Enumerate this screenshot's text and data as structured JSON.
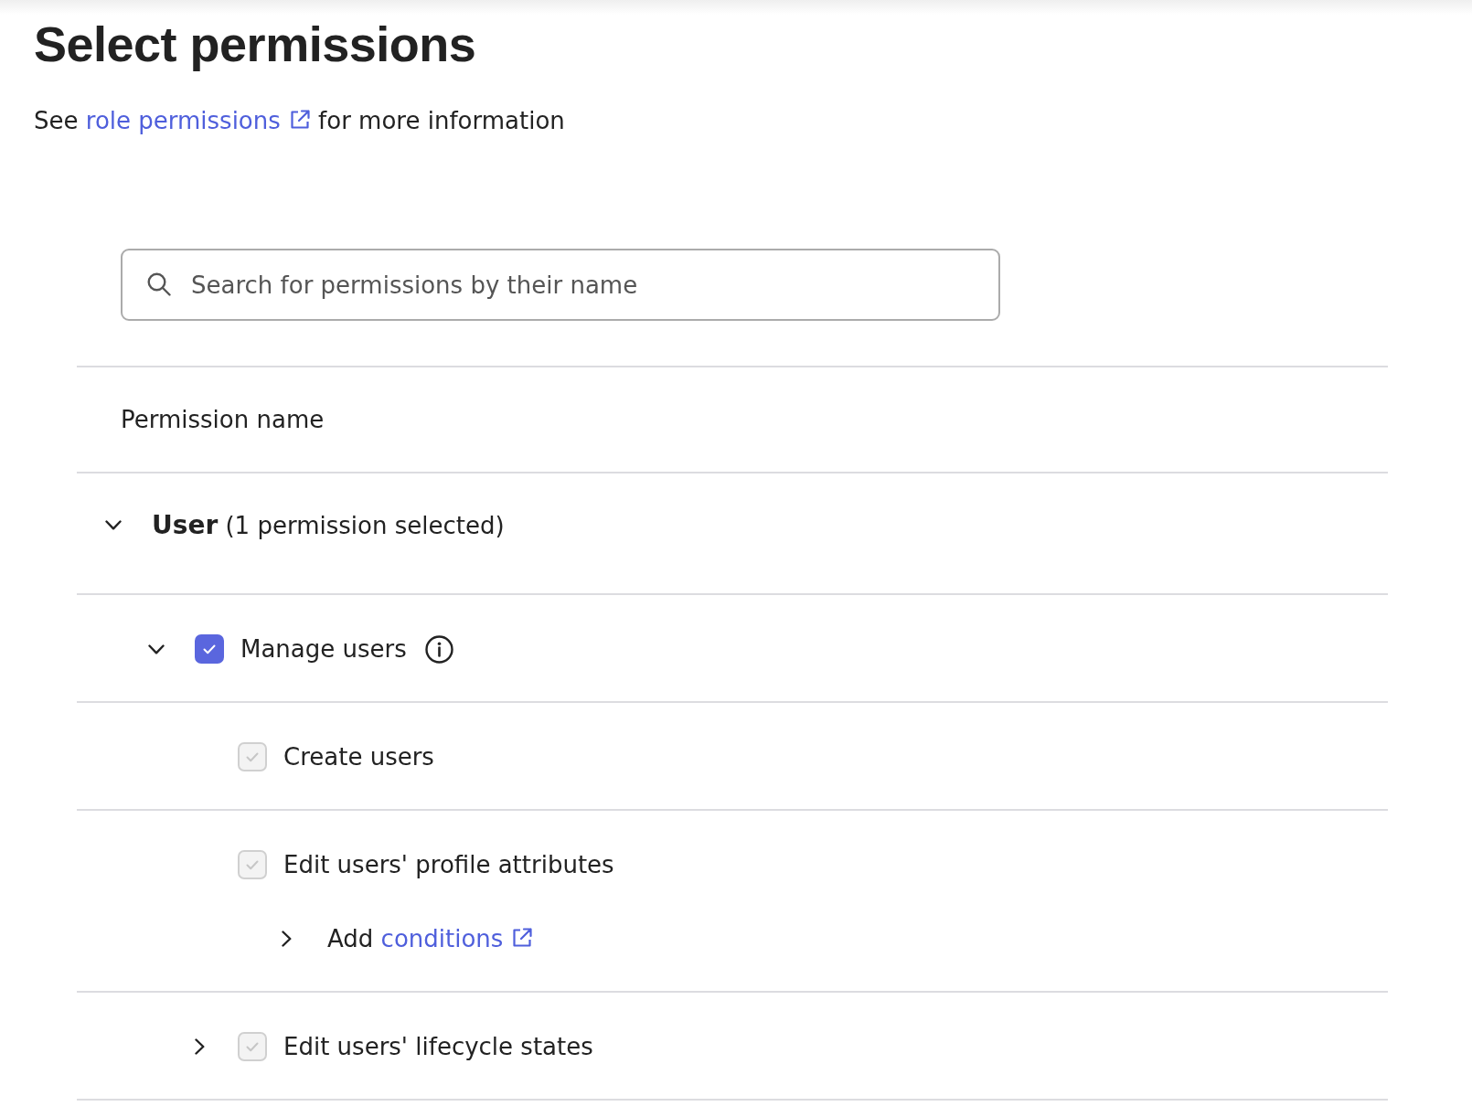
{
  "header": {
    "title": "Select permissions",
    "intro": {
      "before": "See",
      "link": "role permissions",
      "after": "for more information"
    }
  },
  "search": {
    "placeholder": "Search for permissions by their name"
  },
  "table": {
    "columns": [
      "Permission name"
    ],
    "groups": [
      {
        "name": "User",
        "summary": "(1 permission selected)",
        "expanded": true,
        "children": [
          {
            "label": "Manage users",
            "expanded": true,
            "checked": true,
            "disabled": false,
            "info": true,
            "children": [
              {
                "label": "Create users",
                "checked": true,
                "disabled": true
              },
              {
                "label": "Edit users' profile attributes",
                "checked": true,
                "disabled": true,
                "conditions": {
                  "expanded": false,
                  "before": "Add",
                  "link": "conditions"
                }
              },
              {
                "label": "Edit users' lifecycle states",
                "expanded": false,
                "checked": true,
                "disabled": true
              }
            ]
          }
        ]
      }
    ]
  }
}
